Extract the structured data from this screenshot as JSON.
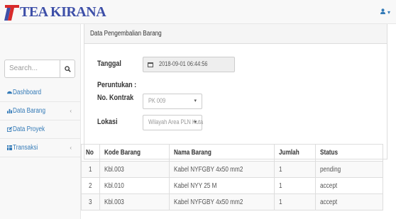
{
  "header": {
    "brand": "TEA KIRANA",
    "user_menu_icon": "user-icon",
    "user_menu_caret": "▾"
  },
  "sidebar": {
    "search_placeholder": "Search...",
    "items": [
      {
        "label": "Dashboard",
        "icon": "dashboard-icon"
      },
      {
        "label": "Data Barang",
        "icon": "bar-chart-icon",
        "arrow": "‹"
      },
      {
        "label": "Data Proyek",
        "icon": "edit-icon"
      },
      {
        "label": "Transaksi",
        "icon": "table-icon",
        "arrow": "‹"
      }
    ]
  },
  "form": {
    "panel_title": "Data Pengembalian Barang",
    "tanggal_label": "Tanggal",
    "tanggal_value": "2018-09-01 06:44:56",
    "peruntukan_label": "Peruntukan :",
    "kontrak_label": "No. Kontrak",
    "kontrak_value": "PK 009",
    "lokasi_label": "Lokasi",
    "lokasi_value": "Wilayah Area PLN Kuta",
    "select_caret": "▾"
  },
  "table": {
    "headers": [
      "No",
      "Kode Barang",
      "Nama Barang",
      "Jumlah",
      "Status"
    ],
    "rows": [
      [
        "1",
        "Kbl.003",
        "Kabel NYFGBY 4x50 mm2",
        "1",
        "pending"
      ],
      [
        "2",
        "Kbl.010",
        "Kabel NYY 25 M",
        "1",
        "accept"
      ],
      [
        "3",
        "Kbl.003",
        "Kabel NYFGBY 4x50 mm2",
        "1",
        "accept"
      ]
    ]
  },
  "colors": {
    "brand": "#3d4fa8",
    "link": "#337ab7",
    "sidebar_bg": "#f8f8f8"
  }
}
